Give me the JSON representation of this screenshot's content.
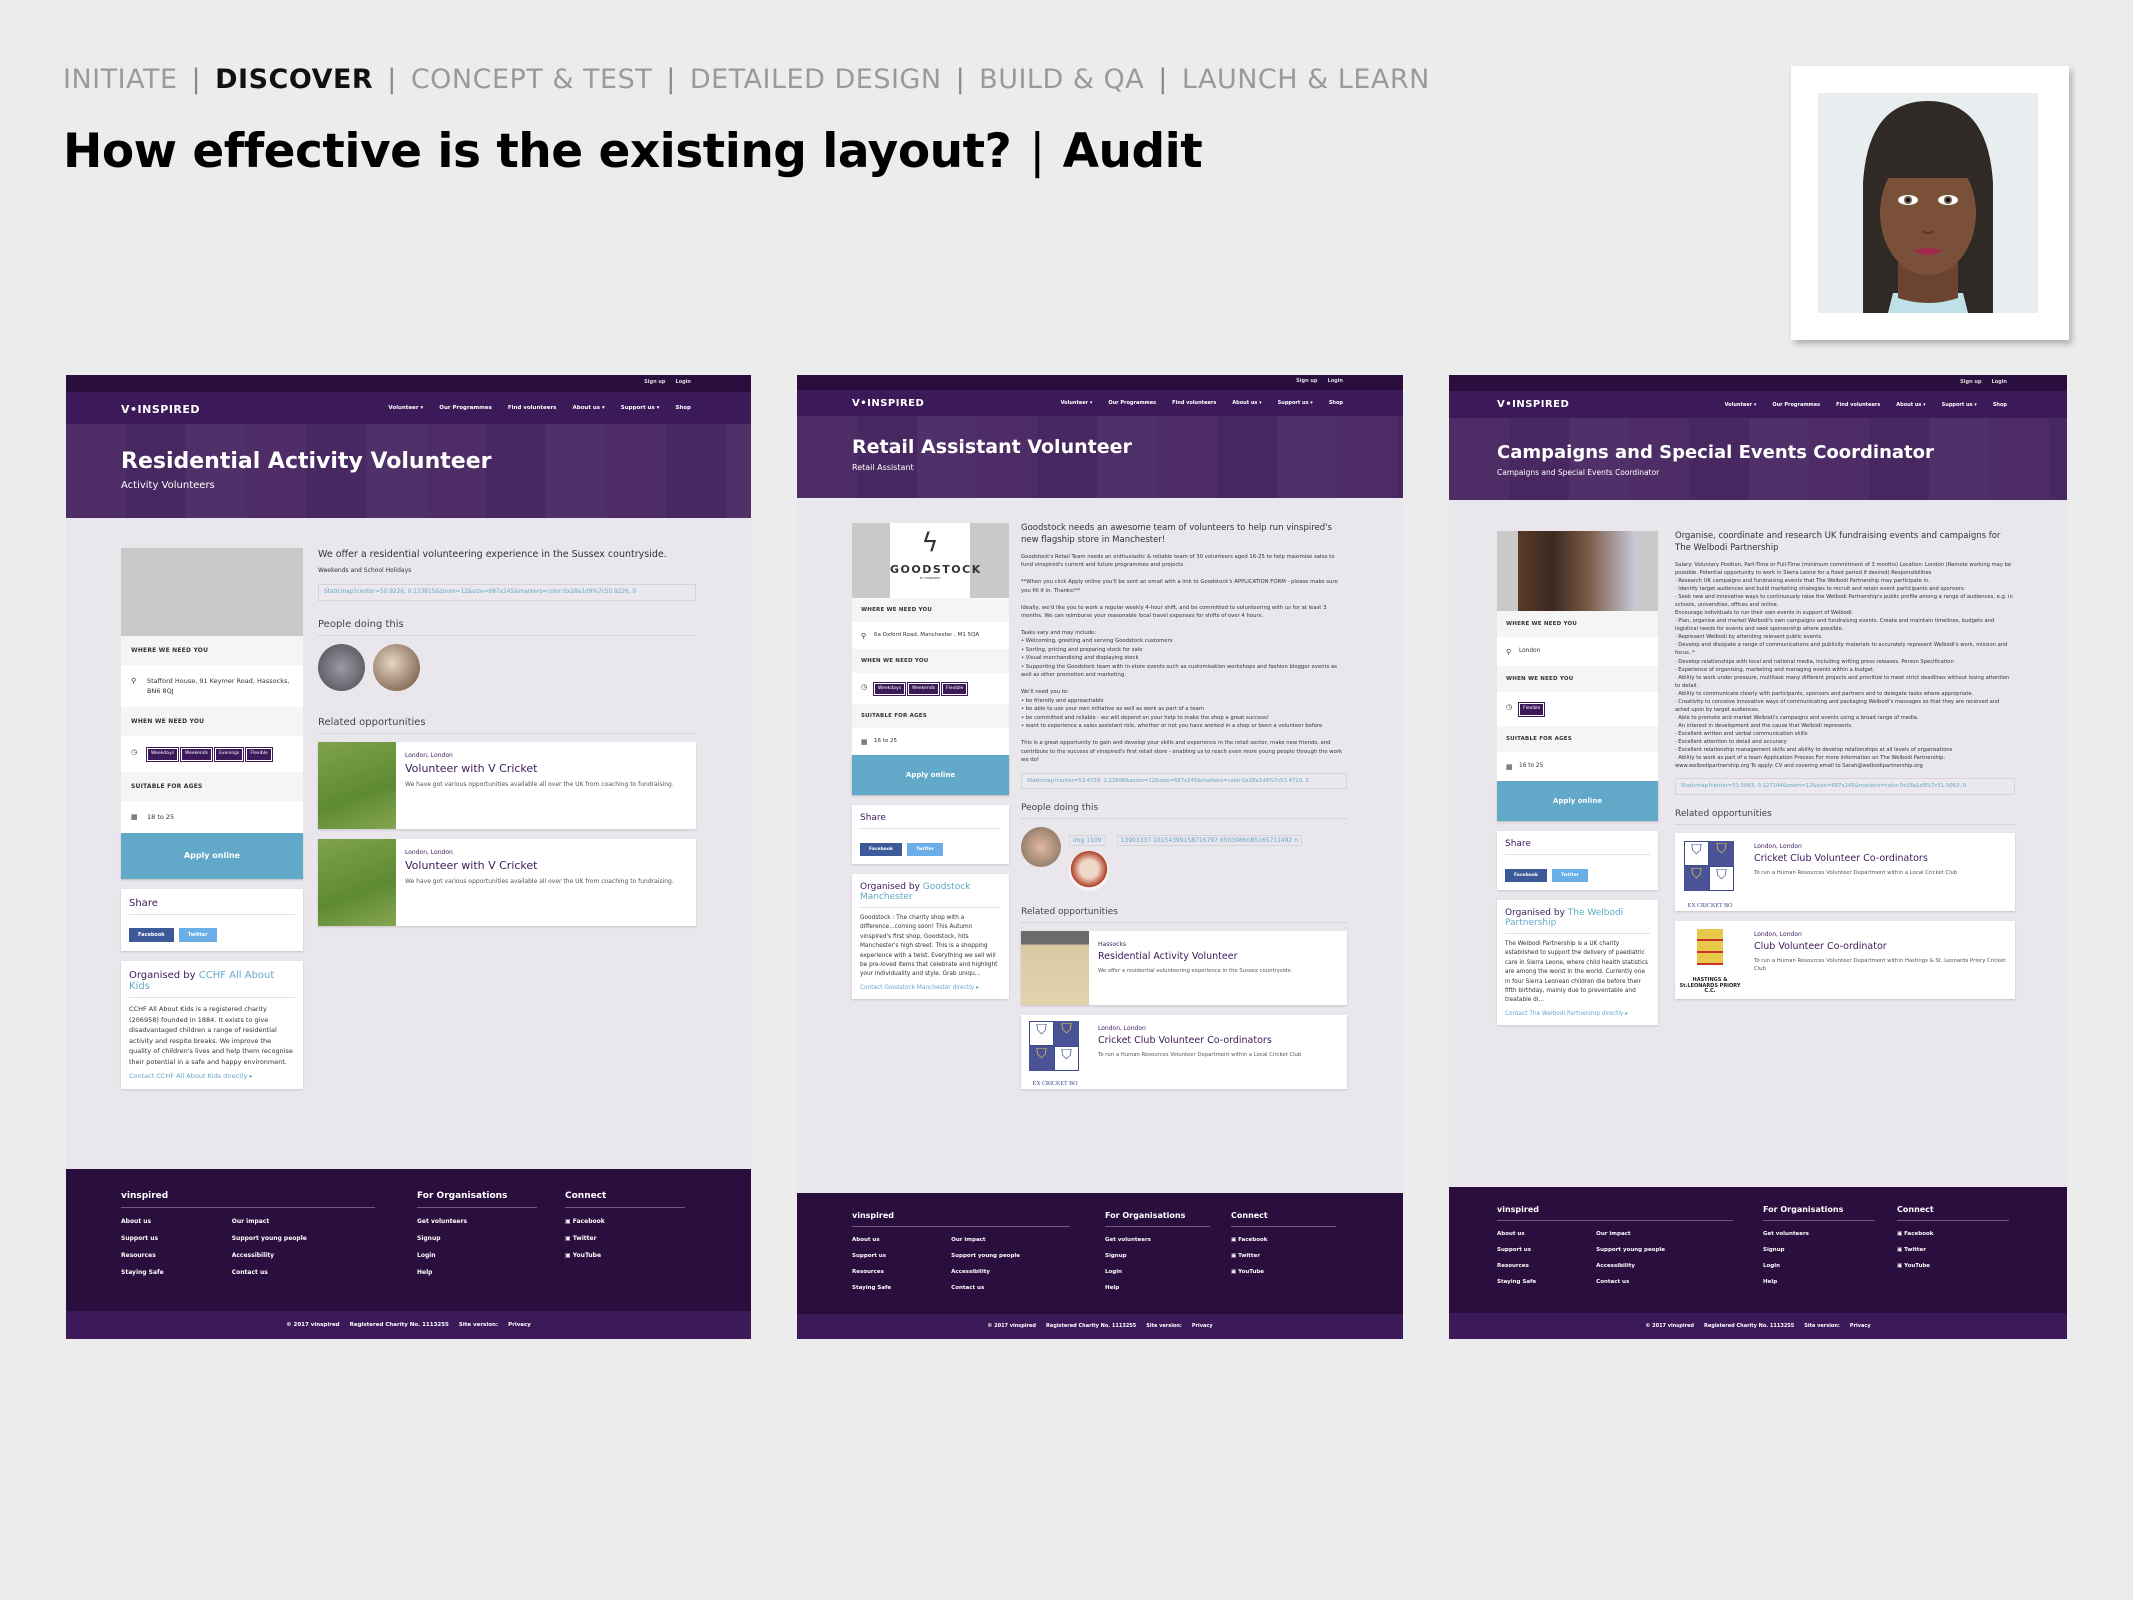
{
  "slide": {
    "phases": [
      {
        "label": "INITIATE",
        "active": false
      },
      {
        "label": "DISCOVER",
        "active": true
      },
      {
        "label": "CONCEPT & TEST",
        "active": false
      },
      {
        "label": "DETAILED DESIGN",
        "active": false
      },
      {
        "label": "BUILD & QA",
        "active": false
      },
      {
        "label": "LAUNCH & LEARN",
        "active": false
      }
    ],
    "title_question": "How effective is the existing layout?",
    "title_separator": "|",
    "title_method": "Audit",
    "persona_avatar": "persona-illustration"
  },
  "site": {
    "topbar": {
      "signup": "Sign up",
      "login": "Login"
    },
    "logo": "V•INSPIRED",
    "nav": [
      "Volunteer ▾",
      "Our Programmes",
      "Find volunteers",
      "About us ▾",
      "Support us ▾",
      "Shop"
    ],
    "labels": {
      "where": "WHERE WE NEED YOU",
      "when": "WHEN WE NEED YOU",
      "ages": "SUITABLE FOR AGES",
      "apply": "Apply online",
      "share": "Share",
      "facebook": "Facebook",
      "twitter": "Twitter",
      "organised_by": "Organised by",
      "people_doing": "People doing this",
      "related": "Related opportunities"
    },
    "footer": {
      "col1_title": "vinspired",
      "col1a": [
        "About us",
        "Support us",
        "Resources",
        "Staying Safe"
      ],
      "col1b": [
        "Our impact",
        "Support young people",
        "Accessibility",
        "Contact us"
      ],
      "col2_title": "For Organisations",
      "col2": [
        "Get volunteers",
        "Signup",
        "Login",
        "Help"
      ],
      "col3_title": "Connect",
      "col3": [
        "Facebook",
        "Twitter",
        "YouTube"
      ],
      "bottom": [
        "© 2017 vinspired",
        "Registered Charity No. 1113255",
        "Site version:",
        "Privacy"
      ]
    }
  },
  "pages": [
    {
      "title": "Residential Activity Volunteer",
      "subtitle": "Activity Volunteers",
      "where": "Stafford House, 91 Keymer Road, Hassocks, BN6 8QJ",
      "when_tags": [
        "Weekdays",
        "Weekends",
        "Evenings",
        "Flexible"
      ],
      "ages": "18 to 25",
      "organiser": "CCHF All About Kids",
      "organiser_desc": "CCHF All About Kids is a registered charity (206958) founded in 1884. It exists to give disadvantaged children a range of residential activity and respite breaks. We improve the quality of children's lives and help them recognise their potential in a safe and happy environment.",
      "contact": "Contact CCHF All About Kids directly ▸",
      "lead": "We offer a residential volunteering experience in the Sussex countryside.",
      "sub": "Weekends and School Holidays",
      "body": "",
      "map": "Staticmap?center=50.9226, 0.133815&zoom=12&size=687x245&markers=color:0x28a1d9%7c50.9226, 0",
      "broken_imgs": [],
      "related": [
        {
          "loc": "London, London",
          "title": "Volunteer with V Cricket",
          "desc": "We have got various opportunities available all over the UK from coaching to fundraising."
        },
        {
          "loc": "London, London",
          "title": "Volunteer with V Cricket",
          "desc": "We have got various opportunities available all over the UK from coaching to fundraising."
        }
      ]
    },
    {
      "title": "Retail Assistant Volunteer",
      "subtitle": "Retail Assistant",
      "logo_text": "GOODSTOCK",
      "logo_sub": "BY VINSPIRED",
      "where": "6a Oxford Road, Manchester , M1 5QA",
      "when_tags": [
        "Weekdays",
        "Weekends",
        "Flexible"
      ],
      "ages": "16 to 25",
      "organiser": "Goodstock Manchester",
      "organiser_desc": "Goodstock : The charity shop with a difference...coming soon! This Autumn vinspired's first shop, Goodstock, hits Manchester's high street. This is a shopping experience with a twist. Everything we sell will be pre-loved items that celebrate and highlight your individuality and style. Grab uniqu...",
      "contact": "Contact Goodstock Manchester directly ▸",
      "lead": "Goodstock needs an awesome team of volunteers to help run vinspired's new flagship store in Manchester!",
      "sub": "",
      "body": "Goodstock's Retail Team needs an enthusiastic & reliable team of 30 volunteers aged 16-25 to help maximise sales to fund vinspired's current and future programmes and projects.\n\n**When you click Apply online you'll be sent an email with a link to Goodstock's APPLICATION FORM - please make sure you fill it in. Thanks!**\n\nIdeally, we'd like you to work a regular weekly 4-hour shift, and be committed to volunteering with us for at least 3 months. We can reimburse your reasonable local travel expenses for shifts of over 4 hours.\n\nTasks vary and may include:\n• Welcoming, greeting and serving Goodstock customers\n• Sorting, pricing and preparing stock for sale\n• Visual merchandising and displaying stock\n• Supporting the Goodstock team with in-store events such as customisation workshops and fashion blogger events as well as other promotion and marketing.\n\nWe'll need you to:\n• be friendly and approachable\n• be able to use your own initiative as well as work as part of a team\n• be committed and reliable - we will depend on your help to make the shop a great success!\n• want to experience a sales assistant role, whether or not you have worked in a shop or been a volunteer before\n\nThis is a great opportunity to gain and develop your skills and experience in the retail sector, make new friends, and contribute to the success of vinspired's first retail store - enabling us to reach even more young people through the work we do!",
      "map": "Staticmap?center=53.4729, 2.23996&zoom=12&size=687x245&markers=color:0x28a1d9%7c53.4729, 2",
      "broken_imgs": [
        "img 1109",
        "13903337 10154399158716797 6503086085165711482 n"
      ],
      "related": [
        {
          "loc": "Hassocks",
          "title": "Residential Activity Volunteer",
          "desc": "We offer a residential volunteering experience in the Sussex countryside."
        },
        {
          "loc": "London, London",
          "title": "Cricket Club Volunteer Co-ordinators",
          "desc": "To run a Human Resources Volunteer Department within a Local Cricket Club",
          "crest_caption": "EX CRICKET BO"
        }
      ]
    },
    {
      "title": "Campaigns and Special Events Coordinator",
      "subtitle": "Campaigns and Special Events Coordinator",
      "where": "London",
      "when_tags": [
        "Flexible"
      ],
      "ages": "16 to 25",
      "organiser": "The Welbodi Partnership",
      "organiser_desc": "The Welbodi Partnership is a UK charity established to support the delivery of paediatric care in Sierra Leone, where child health statistics are among the worst in the world. Currently one in four Sierra Leonean children die before their fifth birthday, mainly due to preventable and treatable di...",
      "contact": "Contact The Welbodi Partnership directly ▸",
      "lead": "Organise, coordinate and research UK fundraising events and campaigns for The Welbodi Partnership",
      "sub": "",
      "body": "Salary: Voluntary Position, Part-Time or Full-Time (minimum commitment of 3 months) Location: London (Remote working may be possible. Potential opportunity to work in Sierra Leone for a fixed period if desired) Responsibilities\n· Research UK campaigns and fundraising events that The Welbodi Partnership may participate in.\n· Identify target audiences and build marketing strategies to recruit and retain event participants and sponsors.\n· Seek new and innovative ways to continuously raise the Welbodi Partnership's public profile among a range of audiences, e.g. in schools, universities, offices and online.\nEncourage individuals to run their own events in support of Welbodi.\n· Plan, organise and market Welbodi's own campaigns and fundraising events. Create and maintain timelines, budgets and logistical needs for events and seek sponsorship where possible.\n· Represent Welbodi by attending relevant public events.\n· Develop and dissipate a range of communications and publicity materials to accurately represent Welbodi's work, mission and focus. *\n· Develop relationships with local and national media, including writing press releases. Person Specification\n· Experience of organising, marketing and managing events within a budget.\n· Ability to work under pressure, multitask many different projects and prioritize to meet strict deadlines without losing attention to detail.\n· Ability to communicate clearly with participants, sponsors and partners and to delegate tasks where appropriate.\n· Creativity to conceive innovative ways of communicating and packaging Welbodi's messages so that they are received and acted upon by target audiences.\n· Able to promote and market Welbodi's campaigns and events using a broad range of media.\n· An interest in development and the cause that Welbodi represents.\n· Excellent written and verbal communication skills\n· Excellent attention to detail and accuracy\n· Excellent relationship management skills and ability to develop relationships at all levels of organisations\n· Ability to work as part of a team Application Process For more information on The Welbodi Partnership: www.welbodipartnership.org To apply: CV and covering email to Sarah@welbodipartnership.org",
      "map": "Staticmap?center=51.5063, 0.127144&zoom=12&size=687x245&markers=color:0x28a1d9%7c51.5063, 0",
      "broken_imgs": [],
      "related": [
        {
          "loc": "London, London",
          "title": "Cricket Club Volunteer Co-ordinators",
          "desc": "To run a Human Resources Volunteer Department within a Local Cricket Club",
          "crest_caption": "EX CRICKET BO"
        },
        {
          "loc": "London, London",
          "title": "Club Volunteer Co-ordinator",
          "desc": "To run a Human Resources Volunteer Department within Hastings & St. Leonards Priory Cricket Club",
          "crest_caption": "HASTINGS & St.LEONARDS PRIORY C.C."
        }
      ]
    }
  ]
}
